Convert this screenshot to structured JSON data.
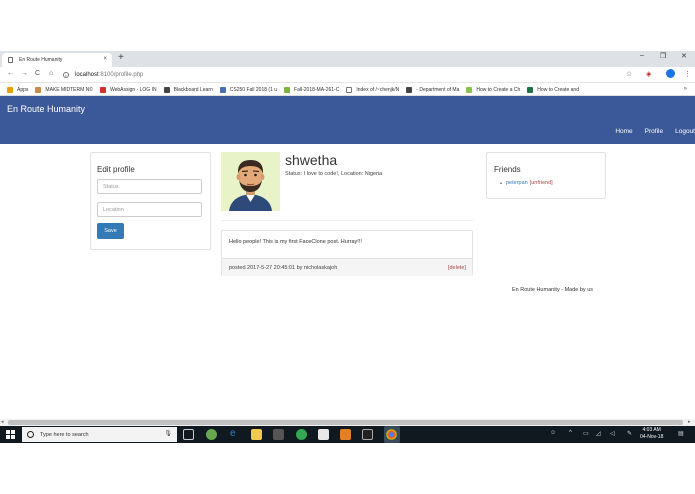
{
  "browser": {
    "tab_title": "En Route Humanity",
    "tab_close": "×",
    "new_tab": "+",
    "window_controls": [
      "–",
      "❐",
      "✕"
    ],
    "url_host": "localhost",
    "url_path": ":8100/profile.php",
    "bookmarks": [
      {
        "label": "Apps",
        "icon": "apps-icon",
        "color": "#e8a000"
      },
      {
        "label": "MAKE MIDTERM N©",
        "icon": "bookmark-icon",
        "color": "#c98a4b"
      },
      {
        "label": "WebAssign - LOG IN",
        "icon": "webassign-icon",
        "color": "#d32f2f"
      },
      {
        "label": "Blackboard Learn",
        "icon": "blackboard-icon",
        "color": "#444444"
      },
      {
        "label": "CS250 Fall 2018 (1 u",
        "icon": "doc-icon",
        "color": "#4a6fb5"
      },
      {
        "label": "Fall-2018-MA-261-C",
        "icon": "piazza-icon",
        "color": "#7cb342"
      },
      {
        "label": "Index of /~chenjk/N",
        "icon": "page-icon",
        "color": "#777777"
      },
      {
        "label": "- Department of Ma",
        "icon": "blackboard-icon",
        "color": "#444444"
      },
      {
        "label": "How to Create a Ch",
        "icon": "wikihow-icon",
        "color": "#8bc34a"
      },
      {
        "label": "How to Create and",
        "icon": "excel-icon",
        "color": "#1e7145"
      }
    ],
    "bookmarks_more": "»"
  },
  "navbar": {
    "brand": "En Route Humanity",
    "links": {
      "home": "Home",
      "profile": "Profile",
      "logout": "Logout"
    },
    "color": "#3b5998"
  },
  "edit_profile": {
    "title": "Edit profile",
    "status_placeholder": "Status",
    "location_placeholder": "Location",
    "save_label": "Save"
  },
  "profile": {
    "name": "shwetha",
    "status_line": "Status: I love to code!, Location: Nigeria"
  },
  "post": {
    "body": "Hello people! This is my first FaceClone post. Hurray!!!",
    "meta": "posted 2017-5-27 20:45:01 by nicholaskajoh",
    "delete_label": "[delete]"
  },
  "friends": {
    "title": "Friends",
    "items": [
      {
        "name": "peterpan",
        "action": "[unfriend]"
      }
    ]
  },
  "footer": "En Route Humanity - Made by us",
  "taskbar": {
    "search_placeholder": "Type here to search",
    "time": "4:03 AM",
    "date": "04-Nov-18"
  }
}
